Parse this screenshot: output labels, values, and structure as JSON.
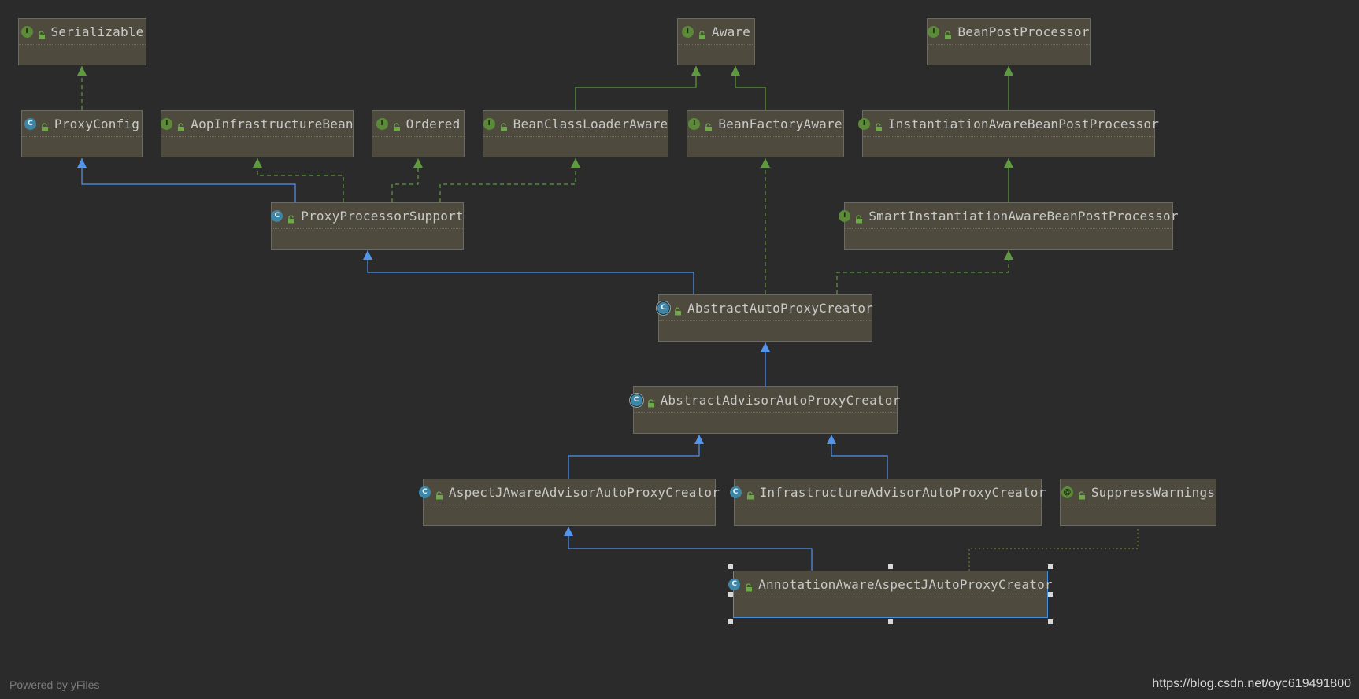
{
  "colors": {
    "background": "#2b2b2b",
    "node_fill": "#4e4a3e",
    "extends_edge": "#5394ec",
    "implements_edge": "#5e9b3f",
    "annotation_edge": "#6b7a2a",
    "selected_border": "#4b8ed8"
  },
  "nodes": [
    {
      "id": "serializable",
      "label": "Serializable",
      "kind": "interface",
      "icon": "interface-icon"
    },
    {
      "id": "aware",
      "label": "Aware",
      "kind": "interface",
      "icon": "interface-icon"
    },
    {
      "id": "bean-post-processor",
      "label": "BeanPostProcessor",
      "kind": "interface",
      "icon": "interface-icon"
    },
    {
      "id": "proxy-config",
      "label": "ProxyConfig",
      "kind": "class",
      "icon": "class-icon"
    },
    {
      "id": "aop-infrastructure-bean",
      "label": "AopInfrastructureBean",
      "kind": "interface",
      "icon": "interface-icon"
    },
    {
      "id": "ordered",
      "label": "Ordered",
      "kind": "interface",
      "icon": "interface-icon"
    },
    {
      "id": "bean-class-loader-aware",
      "label": "BeanClassLoaderAware",
      "kind": "interface",
      "icon": "interface-icon"
    },
    {
      "id": "bean-factory-aware",
      "label": "BeanFactoryAware",
      "kind": "interface",
      "icon": "interface-icon"
    },
    {
      "id": "instantiation-aware-bpp",
      "label": "InstantiationAwareBeanPostProcessor",
      "kind": "interface",
      "icon": "interface-icon"
    },
    {
      "id": "proxy-processor-support",
      "label": "ProxyProcessorSupport",
      "kind": "class",
      "icon": "class-icon"
    },
    {
      "id": "smart-instantiation-aware-bpp",
      "label": "SmartInstantiationAwareBeanPostProcessor",
      "kind": "interface",
      "icon": "interface-icon"
    },
    {
      "id": "abstract-auto-proxy-creator",
      "label": "AbstractAutoProxyCreator",
      "kind": "abstract",
      "icon": "abstract-class-icon"
    },
    {
      "id": "abstract-advisor-auto-proxy-creator",
      "label": "AbstractAdvisorAutoProxyCreator",
      "kind": "abstract",
      "icon": "abstract-class-icon"
    },
    {
      "id": "aspectj-aware-advisor-auto-proxy-creator",
      "label": "AspectJAwareAdvisorAutoProxyCreator",
      "kind": "class",
      "icon": "class-icon"
    },
    {
      "id": "infrastructure-advisor-auto-proxy-creator",
      "label": "InfrastructureAdvisorAutoProxyCreator",
      "kind": "class",
      "icon": "class-icon"
    },
    {
      "id": "suppress-warnings",
      "label": "SuppressWarnings",
      "kind": "annotation",
      "icon": "annotation-icon"
    },
    {
      "id": "annotation-aware-aspectj-auto-proxy-creator",
      "label": "AnnotationAwareAspectJAutoProxyCreator",
      "kind": "class",
      "icon": "class-icon",
      "selected": true
    }
  ],
  "edges": [
    {
      "from": "proxy-config",
      "to": "serializable",
      "type": "implements"
    },
    {
      "from": "bean-class-loader-aware",
      "to": "aware",
      "type": "interface-extends"
    },
    {
      "from": "bean-factory-aware",
      "to": "aware",
      "type": "interface-extends"
    },
    {
      "from": "instantiation-aware-bpp",
      "to": "bean-post-processor",
      "type": "interface-extends"
    },
    {
      "from": "proxy-processor-support",
      "to": "proxy-config",
      "type": "extends"
    },
    {
      "from": "proxy-processor-support",
      "to": "aop-infrastructure-bean",
      "type": "implements"
    },
    {
      "from": "proxy-processor-support",
      "to": "ordered",
      "type": "implements"
    },
    {
      "from": "proxy-processor-support",
      "to": "bean-class-loader-aware",
      "type": "implements"
    },
    {
      "from": "smart-instantiation-aware-bpp",
      "to": "instantiation-aware-bpp",
      "type": "interface-extends"
    },
    {
      "from": "abstract-auto-proxy-creator",
      "to": "proxy-processor-support",
      "type": "extends"
    },
    {
      "from": "abstract-auto-proxy-creator",
      "to": "bean-factory-aware",
      "type": "implements"
    },
    {
      "from": "abstract-auto-proxy-creator",
      "to": "smart-instantiation-aware-bpp",
      "type": "implements"
    },
    {
      "from": "abstract-advisor-auto-proxy-creator",
      "to": "abstract-auto-proxy-creator",
      "type": "extends"
    },
    {
      "from": "aspectj-aware-advisor-auto-proxy-creator",
      "to": "abstract-advisor-auto-proxy-creator",
      "type": "extends"
    },
    {
      "from": "infrastructure-advisor-auto-proxy-creator",
      "to": "abstract-advisor-auto-proxy-creator",
      "type": "extends"
    },
    {
      "from": "annotation-aware-aspectj-auto-proxy-creator",
      "to": "aspectj-aware-advisor-auto-proxy-creator",
      "type": "extends"
    },
    {
      "from": "annotation-aware-aspectj-auto-proxy-creator",
      "to": "suppress-warnings",
      "type": "annotated"
    }
  ],
  "footer": {
    "powered_by": "Powered by yFiles",
    "watermark": "https://blog.csdn.net/oyc619491800"
  }
}
